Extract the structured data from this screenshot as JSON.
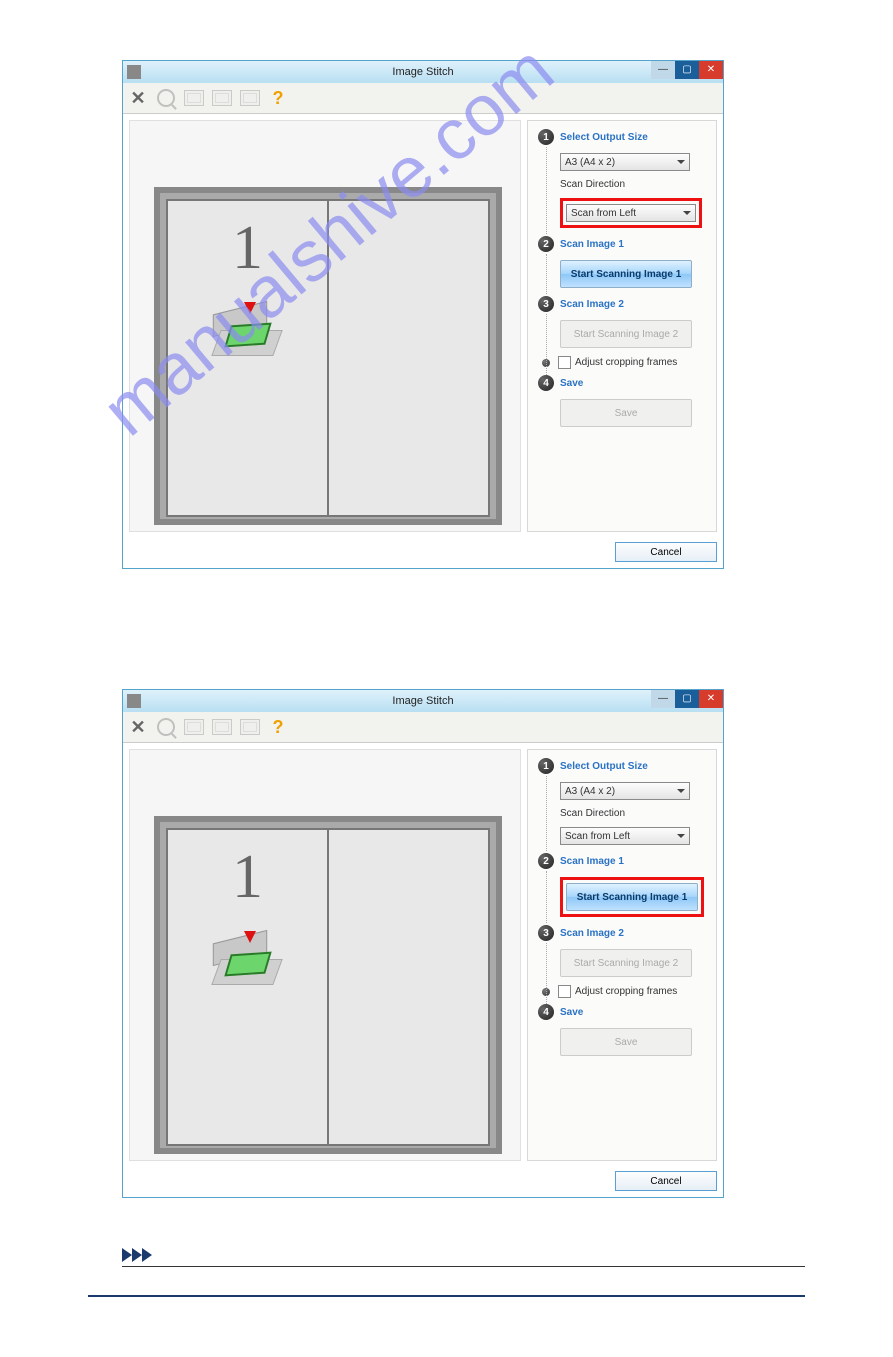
{
  "watermark_text": "manualshive.com",
  "windows": [
    {
      "title": "Image Stitch",
      "highlight": "scan_direction",
      "steps": {
        "s1_label": "Select Output Size",
        "output_size_value": "A3 (A4 x 2)",
        "scan_direction_label": "Scan Direction",
        "scan_direction_value": "Scan from Left",
        "s2_label": "Scan Image 1",
        "btn_scan1_label": "Start Scanning Image 1",
        "s3_label": "Scan Image 2",
        "btn_scan2_label": "Start Scanning Image 2",
        "adjust_crop_label": "Adjust cropping frames",
        "s4_label": "Save",
        "btn_save_label": "Save"
      },
      "cancel_label": "Cancel",
      "page_number": "1"
    },
    {
      "title": "Image Stitch",
      "highlight": "scan1_button",
      "steps": {
        "s1_label": "Select Output Size",
        "output_size_value": "A3 (A4 x 2)",
        "scan_direction_label": "Scan Direction",
        "scan_direction_value": "Scan from Left",
        "s2_label": "Scan Image 1",
        "btn_scan1_label": "Start Scanning Image 1",
        "s3_label": "Scan Image 2",
        "btn_scan2_label": "Start Scanning Image 2",
        "adjust_crop_label": "Adjust cropping frames",
        "s4_label": "Save",
        "btn_save_label": "Save"
      },
      "cancel_label": "Cancel",
      "page_number": "1"
    }
  ]
}
